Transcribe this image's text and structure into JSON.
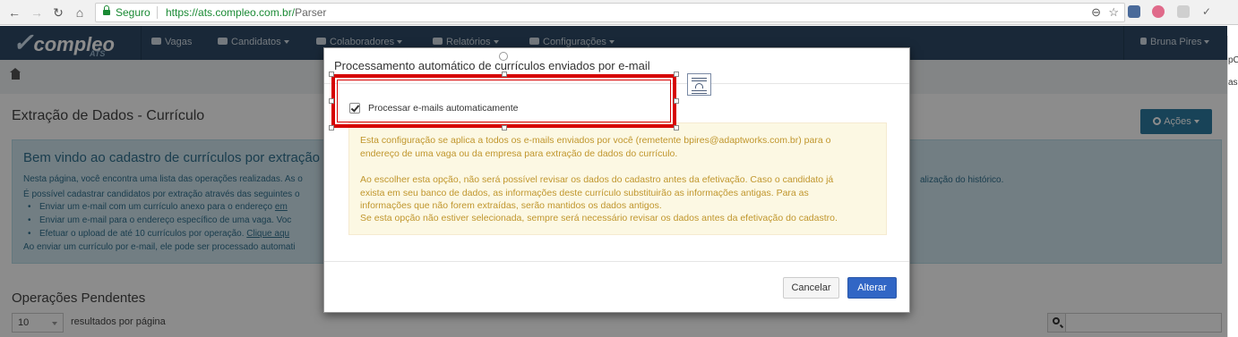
{
  "browser": {
    "secure_label": "Seguro",
    "url_host": "https://ats.compleo.com.br/",
    "url_path": "Parser"
  },
  "navbar": {
    "brand": "compleo",
    "brand_sub": "ATS",
    "items": [
      {
        "label": "Vagas"
      },
      {
        "label": "Candidatos"
      },
      {
        "label": "Colaboradores"
      },
      {
        "label": "Relatórios"
      },
      {
        "label": "Configurações"
      }
    ],
    "user": "Bruna Pires"
  },
  "page": {
    "title": "Extração de Dados - Currículo",
    "actions_label": "Ações",
    "info_title": "Bem vindo ao cadastro de currículos por extração o",
    "info_line1": "Nesta página, você encontra uma lista das operações realizadas. As o",
    "info_line1_tail": "alização do histórico.",
    "info_line2": "É possível cadastrar candidatos por extração através das seguintes o",
    "bullet1_pre": "Enviar um e-mail com um currículo anexo para o endereço ",
    "bullet1_link": "em",
    "bullet2": "Enviar um e-mail para o endereço específico de uma vaga. Voc",
    "bullet3_pre": "Efetuar o upload de até 10 currículos por operação. ",
    "bullet3_link": "Clique aqu",
    "info_line3": "Ao enviar um currículo por e-mail, ele pode ser processado automati",
    "pending_title": "Operações Pendentes",
    "page_size": "10",
    "page_size_label": "resultados por página"
  },
  "edge_fragments": [
    "pC",
    "as"
  ],
  "modal": {
    "title": "Processamento automático de currículos enviados por e-mail",
    "checkbox_label": "Processar e-mails automaticamente",
    "warning_lines": [
      "Esta configuração se aplica a todos os e-mails enviados por você (remetente bpires@adaptworks.com.br) para o",
      "endereço de uma vaga ou da empresa para extração de dados do currículo.",
      "",
      "Ao escolher esta opção, não será possível revisar os dados do cadastro antes da efetivação. Caso o candidato já",
      "exista em seu banco de dados, as informações deste currículo substituirão as informações antigas. Para as",
      "informações que não forem extraídas, serão mantidos os dados antigos.",
      "Se esta opção não estiver selecionada, sempre será necessário revisar os dados antes da efetivação do cadastro."
    ],
    "cancel_label": "Cancelar",
    "confirm_label": "Alterar"
  }
}
